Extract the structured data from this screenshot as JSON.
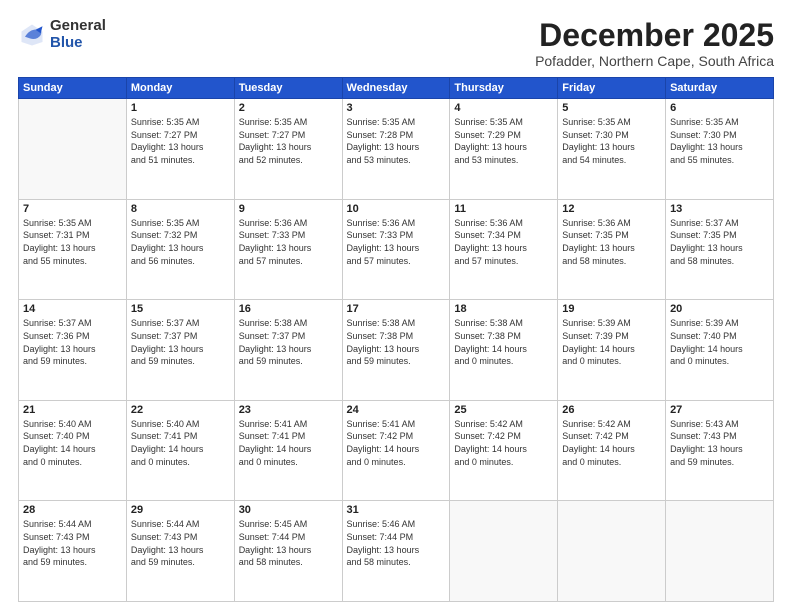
{
  "header": {
    "logo_general": "General",
    "logo_blue": "Blue",
    "month_title": "December 2025",
    "subtitle": "Pofadder, Northern Cape, South Africa"
  },
  "days_of_week": [
    "Sunday",
    "Monday",
    "Tuesday",
    "Wednesday",
    "Thursday",
    "Friday",
    "Saturday"
  ],
  "weeks": [
    [
      {
        "day": "",
        "info": ""
      },
      {
        "day": "1",
        "info": "Sunrise: 5:35 AM\nSunset: 7:27 PM\nDaylight: 13 hours\nand 51 minutes."
      },
      {
        "day": "2",
        "info": "Sunrise: 5:35 AM\nSunset: 7:27 PM\nDaylight: 13 hours\nand 52 minutes."
      },
      {
        "day": "3",
        "info": "Sunrise: 5:35 AM\nSunset: 7:28 PM\nDaylight: 13 hours\nand 53 minutes."
      },
      {
        "day": "4",
        "info": "Sunrise: 5:35 AM\nSunset: 7:29 PM\nDaylight: 13 hours\nand 53 minutes."
      },
      {
        "day": "5",
        "info": "Sunrise: 5:35 AM\nSunset: 7:30 PM\nDaylight: 13 hours\nand 54 minutes."
      },
      {
        "day": "6",
        "info": "Sunrise: 5:35 AM\nSunset: 7:30 PM\nDaylight: 13 hours\nand 55 minutes."
      }
    ],
    [
      {
        "day": "7",
        "info": "Sunrise: 5:35 AM\nSunset: 7:31 PM\nDaylight: 13 hours\nand 55 minutes."
      },
      {
        "day": "8",
        "info": "Sunrise: 5:35 AM\nSunset: 7:32 PM\nDaylight: 13 hours\nand 56 minutes."
      },
      {
        "day": "9",
        "info": "Sunrise: 5:36 AM\nSunset: 7:33 PM\nDaylight: 13 hours\nand 57 minutes."
      },
      {
        "day": "10",
        "info": "Sunrise: 5:36 AM\nSunset: 7:33 PM\nDaylight: 13 hours\nand 57 minutes."
      },
      {
        "day": "11",
        "info": "Sunrise: 5:36 AM\nSunset: 7:34 PM\nDaylight: 13 hours\nand 57 minutes."
      },
      {
        "day": "12",
        "info": "Sunrise: 5:36 AM\nSunset: 7:35 PM\nDaylight: 13 hours\nand 58 minutes."
      },
      {
        "day": "13",
        "info": "Sunrise: 5:37 AM\nSunset: 7:35 PM\nDaylight: 13 hours\nand 58 minutes."
      }
    ],
    [
      {
        "day": "14",
        "info": "Sunrise: 5:37 AM\nSunset: 7:36 PM\nDaylight: 13 hours\nand 59 minutes."
      },
      {
        "day": "15",
        "info": "Sunrise: 5:37 AM\nSunset: 7:37 PM\nDaylight: 13 hours\nand 59 minutes."
      },
      {
        "day": "16",
        "info": "Sunrise: 5:38 AM\nSunset: 7:37 PM\nDaylight: 13 hours\nand 59 minutes."
      },
      {
        "day": "17",
        "info": "Sunrise: 5:38 AM\nSunset: 7:38 PM\nDaylight: 13 hours\nand 59 minutes."
      },
      {
        "day": "18",
        "info": "Sunrise: 5:38 AM\nSunset: 7:38 PM\nDaylight: 14 hours\nand 0 minutes."
      },
      {
        "day": "19",
        "info": "Sunrise: 5:39 AM\nSunset: 7:39 PM\nDaylight: 14 hours\nand 0 minutes."
      },
      {
        "day": "20",
        "info": "Sunrise: 5:39 AM\nSunset: 7:40 PM\nDaylight: 14 hours\nand 0 minutes."
      }
    ],
    [
      {
        "day": "21",
        "info": "Sunrise: 5:40 AM\nSunset: 7:40 PM\nDaylight: 14 hours\nand 0 minutes."
      },
      {
        "day": "22",
        "info": "Sunrise: 5:40 AM\nSunset: 7:41 PM\nDaylight: 14 hours\nand 0 minutes."
      },
      {
        "day": "23",
        "info": "Sunrise: 5:41 AM\nSunset: 7:41 PM\nDaylight: 14 hours\nand 0 minutes."
      },
      {
        "day": "24",
        "info": "Sunrise: 5:41 AM\nSunset: 7:42 PM\nDaylight: 14 hours\nand 0 minutes."
      },
      {
        "day": "25",
        "info": "Sunrise: 5:42 AM\nSunset: 7:42 PM\nDaylight: 14 hours\nand 0 minutes."
      },
      {
        "day": "26",
        "info": "Sunrise: 5:42 AM\nSunset: 7:42 PM\nDaylight: 14 hours\nand 0 minutes."
      },
      {
        "day": "27",
        "info": "Sunrise: 5:43 AM\nSunset: 7:43 PM\nDaylight: 13 hours\nand 59 minutes."
      }
    ],
    [
      {
        "day": "28",
        "info": "Sunrise: 5:44 AM\nSunset: 7:43 PM\nDaylight: 13 hours\nand 59 minutes."
      },
      {
        "day": "29",
        "info": "Sunrise: 5:44 AM\nSunset: 7:43 PM\nDaylight: 13 hours\nand 59 minutes."
      },
      {
        "day": "30",
        "info": "Sunrise: 5:45 AM\nSunset: 7:44 PM\nDaylight: 13 hours\nand 58 minutes."
      },
      {
        "day": "31",
        "info": "Sunrise: 5:46 AM\nSunset: 7:44 PM\nDaylight: 13 hours\nand 58 minutes."
      },
      {
        "day": "",
        "info": ""
      },
      {
        "day": "",
        "info": ""
      },
      {
        "day": "",
        "info": ""
      }
    ]
  ]
}
